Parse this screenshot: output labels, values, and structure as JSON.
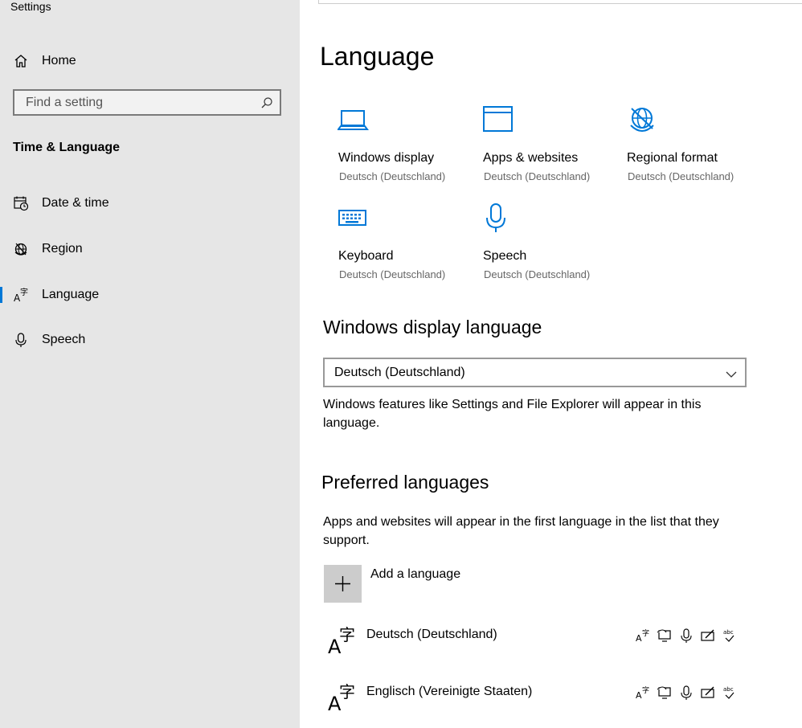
{
  "window": {
    "title": "Settings"
  },
  "sidebar": {
    "home_label": "Home",
    "search_placeholder": "Find a setting",
    "section_title": "Time & Language",
    "items": [
      {
        "label": "Date & time",
        "icon": "calendar-clock-icon"
      },
      {
        "label": "Region",
        "icon": "globe-icon"
      },
      {
        "label": "Language",
        "icon": "language-icon",
        "selected": true
      },
      {
        "label": "Speech",
        "icon": "microphone-icon"
      }
    ]
  },
  "main": {
    "title": "Language",
    "tiles": [
      {
        "name": "Windows display",
        "sub": "Deutsch (Deutschland)",
        "icon": "laptop-icon"
      },
      {
        "name": "Apps & websites",
        "sub": "Deutsch (Deutschland)",
        "icon": "window-icon"
      },
      {
        "name": "Regional format",
        "sub": "Deutsch (Deutschland)",
        "icon": "globe-icon"
      },
      {
        "name": "Keyboard",
        "sub": "Deutsch (Deutschland)",
        "icon": "keyboard-icon"
      },
      {
        "name": "Speech",
        "sub": "Deutsch (Deutschland)",
        "icon": "microphone-icon"
      }
    ],
    "display_language": {
      "heading": "Windows display language",
      "selected": "Deutsch (Deutschland)",
      "description": "Windows features like Settings and File Explorer will appear in this language."
    },
    "preferred": {
      "heading": "Preferred languages",
      "description": "Apps and websites will appear in the first language in the list that they support.",
      "add_label": "Add a language",
      "languages": [
        {
          "name": "Deutsch (Deutschland)"
        },
        {
          "name": "Englisch (Vereinigte Staaten)"
        }
      ]
    }
  },
  "colors": {
    "accent": "#0078d7",
    "sidebar_bg": "#e6e6e6"
  }
}
